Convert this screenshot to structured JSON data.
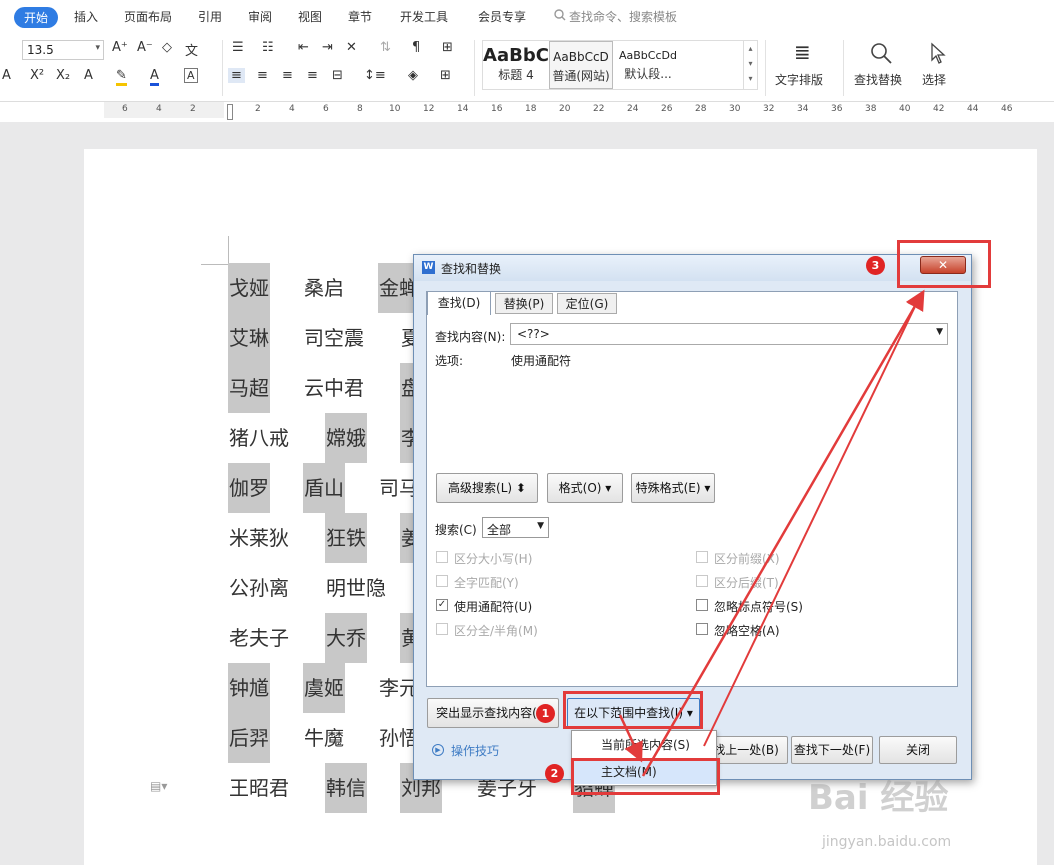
{
  "tabs": [
    "开始",
    "插入",
    "页面布局",
    "引用",
    "审阅",
    "视图",
    "章节",
    "开发工具",
    "会员专享"
  ],
  "search_cmd": "查找命令、搜索模板",
  "ribbon": {
    "font_size": "13.5",
    "styles": [
      {
        "sample": "AaBbC",
        "label": "标题 4"
      },
      {
        "sample": "AaBbCcD",
        "label": "普通(网站)"
      },
      {
        "sample": "AaBbCcDd",
        "label": "默认段..."
      }
    ],
    "text_layout": "文字排版",
    "find_replace": "查找替换",
    "select": "选择"
  },
  "ruler_marks": [
    "6",
    "4",
    "2",
    "2",
    "4",
    "6",
    "8",
    "10",
    "12",
    "14",
    "16",
    "18",
    "20",
    "22",
    "24",
    "26",
    "28",
    "30",
    "32",
    "34",
    "36",
    "38",
    "40",
    "42",
    "44",
    "46"
  ],
  "names": [
    [
      "戈娅",
      "桑启",
      "金蝉"
    ],
    [
      "艾琳",
      "司空震",
      "夏"
    ],
    [
      "马超",
      "云中君",
      "盘"
    ],
    [
      "猪八戒",
      "嫦娥",
      "李"
    ],
    [
      "伽罗",
      "盾山",
      "司马"
    ],
    [
      "米莱狄",
      "狂铁",
      "姜"
    ],
    [
      "公孙离",
      "明世隐",
      ""
    ],
    [
      "老夫子",
      "大乔",
      "黄"
    ],
    [
      "钟馗",
      "虞姬",
      "李元"
    ],
    [
      "后羿",
      "牛魔",
      "孙悟"
    ],
    [
      "王昭君",
      "韩信",
      "刘邦",
      "姜子牙",
      "貂蝉"
    ]
  ],
  "dialog": {
    "title": "查找和替换",
    "tabs": [
      "查找(D)",
      "替换(P)",
      "定位(G)"
    ],
    "find_label": "查找内容(N):",
    "find_value": "<??>",
    "options_label": "选项:",
    "options_value": "使用通配符",
    "btn_advanced": "高级搜索(L) ⬍",
    "btn_format": "格式(O) ▾",
    "btn_special": "特殊格式(E) ▾",
    "search_label": "搜索(C)",
    "search_value": "全部",
    "checks_left": [
      "区分大小写(H)",
      "全字匹配(Y)",
      "使用通配符(U)",
      "区分全/半角(M)"
    ],
    "checks_right": [
      "区分前缀(X)",
      "区分后缀(T)",
      "忽略标点符号(S)",
      "忽略空格(A)"
    ],
    "btn_highlight": "突出显示查找内容(R)",
    "btn_find_in": "在以下范围中查找(I) ▾",
    "btn_prev": "找上一处(B)",
    "btn_next": "查找下一处(F)",
    "btn_close": "关闭",
    "tips": "操作技巧",
    "menu": [
      "当前所选内容(S)",
      "主文档(M)"
    ]
  },
  "annotations": [
    "1",
    "2",
    "3"
  ],
  "watermark": {
    "brand": "Bai 经验",
    "url": "jingyan.baidu.com"
  }
}
